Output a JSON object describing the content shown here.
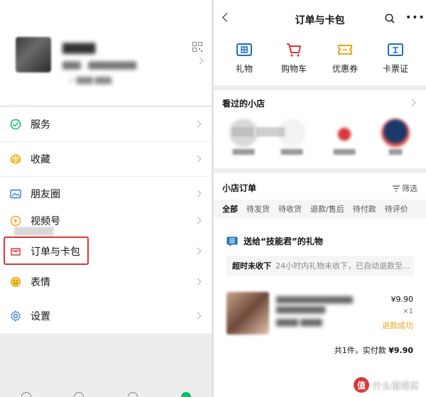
{
  "left_panel": {
    "menu_items": [
      {
        "label": "服务",
        "icon": "service-icon"
      },
      {
        "label": "收藏",
        "icon": "favorites-icon"
      },
      {
        "label": "朋友圈",
        "icon": "moments-icon"
      },
      {
        "label": "视频号",
        "icon": "channels-icon"
      },
      {
        "label": "订单与卡包",
        "icon": "orders-icon"
      },
      {
        "label": "表情",
        "icon": "emoji-icon"
      },
      {
        "label": "设置",
        "icon": "settings-icon"
      }
    ],
    "highlight_color": "#d9383a"
  },
  "right_panel": {
    "title": "订单与卡包",
    "quick_actions": [
      {
        "label": "礼物",
        "icon": "gift-icon"
      },
      {
        "label": "购物车",
        "icon": "cart-icon"
      },
      {
        "label": "优惠券",
        "icon": "coupon-icon"
      },
      {
        "label": "卡票证",
        "icon": "card-icon"
      }
    ],
    "visited_shops": {
      "title": "看过的小店"
    },
    "orders": {
      "title": "小店订单",
      "filter_label": "筛选",
      "tabs": [
        "全部",
        "待发货",
        "待收货",
        "退款/售后",
        "待付款",
        "待评价"
      ],
      "gift_label": "送给“技能君”的礼物",
      "timeout_title": "超时未收下",
      "timeout_note": "24小时内礼物未收下，已自动退款至...",
      "price": "¥9.90",
      "quantity": "×1",
      "status": "退款成功",
      "total_prefix": "共1件，实付款",
      "total_amount": "¥9.90"
    },
    "watermark": {
      "badge": "值",
      "text": "什么值得买"
    }
  },
  "colors": {
    "accent_green": "#07c160",
    "refund_orange": "#f0a31c",
    "icon_blue": "#1e6fb8"
  }
}
